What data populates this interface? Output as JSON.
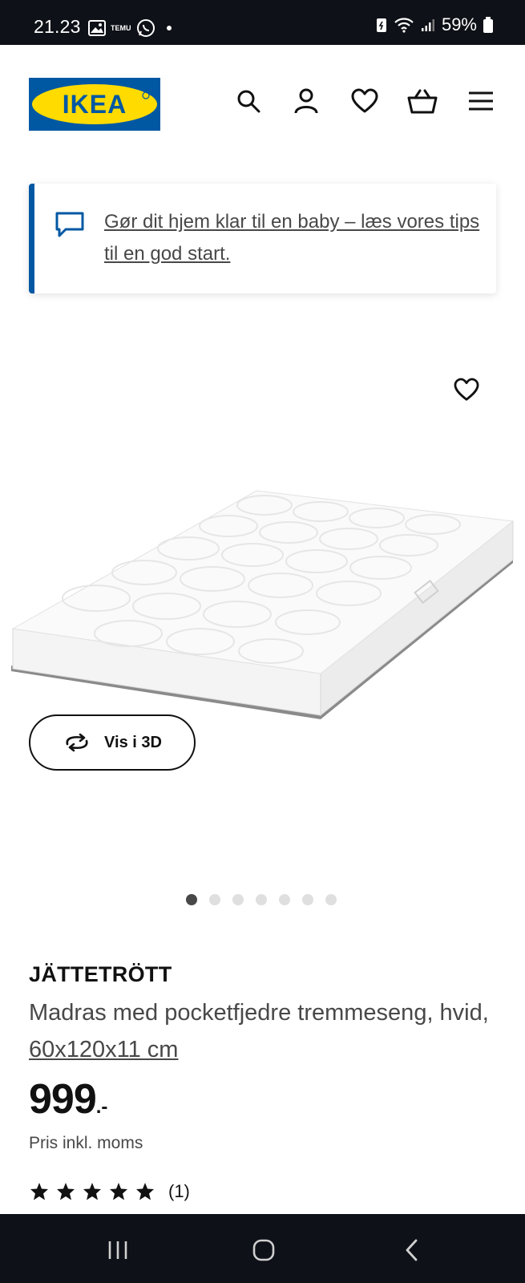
{
  "status_bar": {
    "time": "21.23",
    "battery": "59%",
    "mini_label": "TEMU"
  },
  "header": {
    "logo_text": "IKEA"
  },
  "banner": {
    "text": "Gør dit hjem klar til en baby – læs vores tips til en god start."
  },
  "gallery": {
    "button_label": "Vis i 3D",
    "dot_count": 7,
    "active_index": 0
  },
  "product": {
    "name": "JÄTTETRÖTT",
    "description": "Madras med pocketfjedre tremmeseng, hvid,",
    "dimensions": "60x120x11 cm",
    "price_integer": "999",
    "price_suffix": ".-",
    "price_note": "Pris inkl. moms",
    "rating_value": 5,
    "rating_max": 5,
    "rating_count": "(1)"
  },
  "colors": {
    "ikea_blue": "#0058a3",
    "ikea_yellow": "#ffdb00",
    "text_dark": "#111111",
    "text_muted": "#484848"
  }
}
